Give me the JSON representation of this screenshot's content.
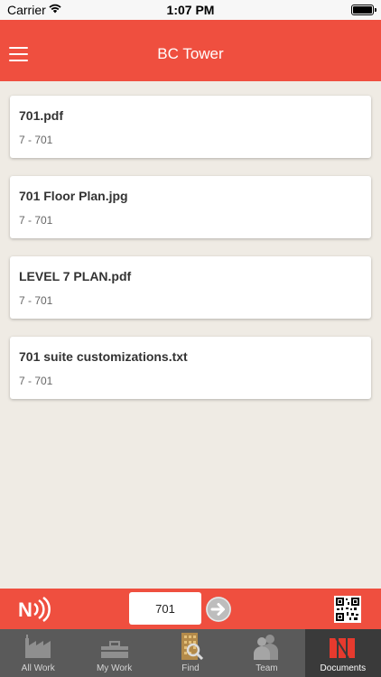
{
  "status": {
    "carrier": "Carrier",
    "time": "1:07 PM"
  },
  "header": {
    "title": "BC Tower"
  },
  "documents": [
    {
      "name": "701.pdf",
      "sub": "7 - 701"
    },
    {
      "name": "701 Floor Plan.jpg",
      "sub": "7 - 701"
    },
    {
      "name": "LEVEL 7 PLAN.pdf",
      "sub": "7 - 701"
    },
    {
      "name": "701 suite customizations.txt",
      "sub": "7 - 701"
    }
  ],
  "input_bar": {
    "unit_value": "701"
  },
  "tabs": [
    {
      "label": "All Work",
      "icon": "factory-icon"
    },
    {
      "label": "My Work",
      "icon": "toolbox-icon"
    },
    {
      "label": "Find",
      "icon": "find-building-icon"
    },
    {
      "label": "Team",
      "icon": "team-icon"
    },
    {
      "label": "Documents",
      "icon": "documents-icon",
      "active": true
    }
  ],
  "colors": {
    "accent": "#ef4f3f",
    "tab_bg": "#5a5a5a",
    "background": "#efebe4"
  }
}
